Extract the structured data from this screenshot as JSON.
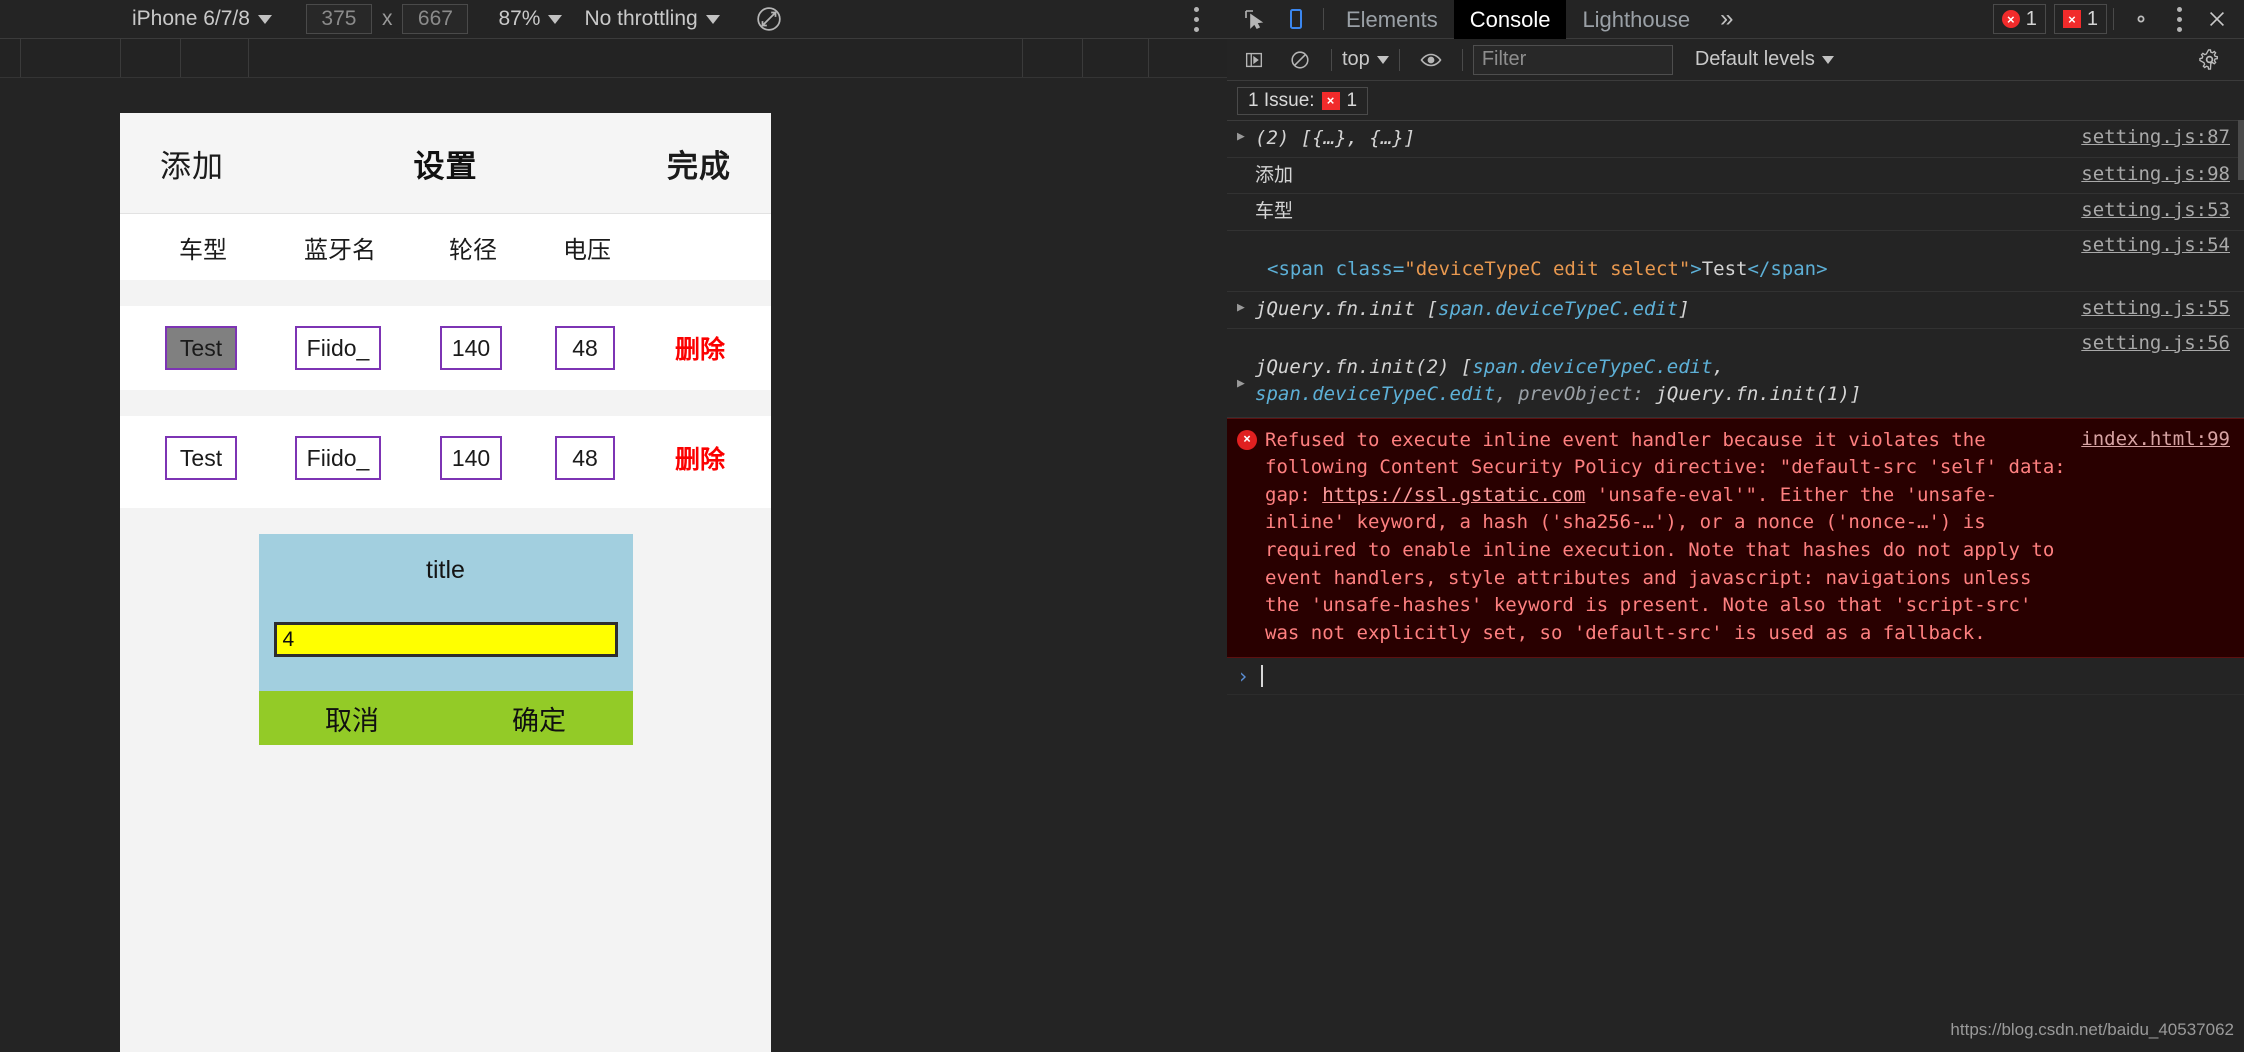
{
  "device_toolbar": {
    "device_label": "iPhone 6/7/8",
    "width": "375",
    "height": "667",
    "times": "x",
    "zoom": "87%",
    "throttling": "No throttling",
    "rotate_icon": "rotate-icon",
    "more_icon": "more-vertical-icon"
  },
  "phone": {
    "header": {
      "add": "添加",
      "title": "设置",
      "done": "完成"
    },
    "columns": [
      "车型",
      "蓝牙名",
      "轮径",
      "电压"
    ],
    "rows": [
      {
        "type": "Test",
        "bluetooth": "Fiido_",
        "wheel": "140",
        "voltage": "48",
        "delete": "删除",
        "selected": true
      },
      {
        "type": "Test",
        "bluetooth": "Fiido_",
        "wheel": "140",
        "voltage": "48",
        "delete": "删除",
        "selected": false
      }
    ],
    "modal": {
      "title": "title",
      "input_value": "4",
      "cancel": "取消",
      "confirm": "确定"
    }
  },
  "devtools": {
    "tabs": [
      {
        "label": "Elements",
        "active": false
      },
      {
        "label": "Console",
        "active": true
      },
      {
        "label": "Lighthouse",
        "active": false
      }
    ],
    "overflow": "»",
    "error_count": "1",
    "warning_count": "1",
    "settings_icon": "gear-icon",
    "more_icon": "more-vertical-icon",
    "close_icon": "close-icon",
    "inspect_icon": "inspect-cursor-icon",
    "device_icon": "device-toggle-icon",
    "console_toolbar": {
      "sidebar_icon": "console-sidebar-icon",
      "clear_icon": "clear-console-icon",
      "context": "top",
      "eye_icon": "live-expression-icon",
      "filter_placeholder": "Filter",
      "levels": "Default levels",
      "settings_icon": "gear-icon"
    },
    "issue_bar": {
      "label": "1 Issue:",
      "count": "1"
    },
    "messages": [
      {
        "kind": "object",
        "expandable": true,
        "text": "(2) [{…}, {…}]",
        "source": "setting.js:87"
      },
      {
        "kind": "log",
        "expandable": false,
        "text": "添加",
        "source": "setting.js:98"
      },
      {
        "kind": "log",
        "expandable": false,
        "text": "车型",
        "source": "setting.js:53"
      },
      {
        "kind": "html",
        "expandable": false,
        "html_open": "<span class=",
        "html_attr": "\"deviceTypeC edit select\"",
        "html_gt": ">",
        "html_text": "Test",
        "html_close": "</span>",
        "source": "setting.js:54"
      },
      {
        "kind": "jquery",
        "expandable": true,
        "prefix": "jQuery.fn.init [",
        "selector": "span.deviceTypeC.edit",
        "suffix": "]",
        "source": "setting.js:55"
      },
      {
        "kind": "jquery2",
        "expandable": true,
        "line1_prefix": "jQuery.fn.init(2) [",
        "line1_sel": "span.deviceTypeC.edit",
        "line1_suffix": ",",
        "line2_sel": "span.deviceTypeC.edit",
        "line2_mid": ", prevObject: ",
        "line2_tail": "jQuery.fn.init(1)]",
        "source": "setting.js:56"
      }
    ],
    "error": {
      "icon_glyph": "×",
      "part1": "Refused to execute inline event handler because it violates the following Content Security Policy directive: \"default-src 'self' data: gap: ",
      "link": "https://ssl.gstatic.com",
      "part2": " 'unsafe-eval'\". Either the 'unsafe-inline' keyword, a hash ('sha256-…'), or a nonce ('nonce-…') is required to enable inline execution. Note that hashes do not apply to event handlers, style attributes and javascript: navigations unless the 'unsafe-hashes' keyword is present. Note also that 'script-src' was not explicitly set, so 'default-src' is used as a fallback.",
      "source": "index.html:99"
    },
    "prompt_chevron": "›"
  },
  "watermark": "https://blog.csdn.net/baidu_40537062",
  "colors": {
    "accent_purple": "#7d34b4",
    "delete_red": "#fb0000",
    "modal_blue": "#a2cfdf",
    "modal_green": "#93cb27",
    "modal_yellow": "#ffff00",
    "error_bg": "#290000",
    "error_text": "#ff8080"
  }
}
